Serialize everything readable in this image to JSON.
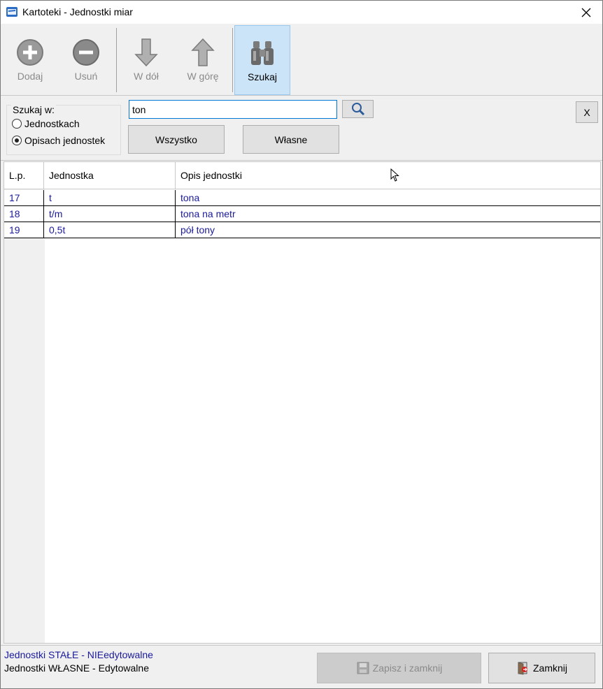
{
  "window": {
    "title": "Kartoteki - Jednostki miar"
  },
  "toolbar": {
    "add_label": "Dodaj",
    "remove_label": "Usuń",
    "down_label": "W dół",
    "up_label": "W górę",
    "search_label": "Szukaj"
  },
  "search": {
    "group_title": "Szukaj w:",
    "option_units": "Jednostkach",
    "option_descriptions": "Opisach jednostek",
    "selected_option": "Opisach jednostek",
    "query": "ton",
    "all_label": "Wszystko",
    "own_label": "Własne",
    "clear_label": "X"
  },
  "grid": {
    "columns": [
      "L.p.",
      "Jednostka",
      "Opis jednostki"
    ],
    "rows": [
      {
        "lp": "17",
        "unit": "t",
        "description": "tona"
      },
      {
        "lp": "18",
        "unit": "t/m",
        "description": "tona na metr"
      },
      {
        "lp": "19",
        "unit": "0,5t",
        "description": "pół tony"
      }
    ]
  },
  "status": {
    "fixed_units": "Jednostki STAŁE - NIEedytowalne",
    "own_units": "Jednostki WŁASNE - Edytowalne",
    "save_close_label": "Zapisz i zamknij",
    "close_label": "Zamknij"
  },
  "colors": {
    "accent": "#0078d7",
    "row_text": "#1a1a9a",
    "active_tool": "#cce4f7"
  },
  "icons": [
    "app-icon",
    "close-icon",
    "plus-circle-icon",
    "minus-circle-icon",
    "arrow-down-icon",
    "arrow-up-icon",
    "binoculars-icon",
    "magnifier-icon",
    "save-icon",
    "exit-icon"
  ]
}
